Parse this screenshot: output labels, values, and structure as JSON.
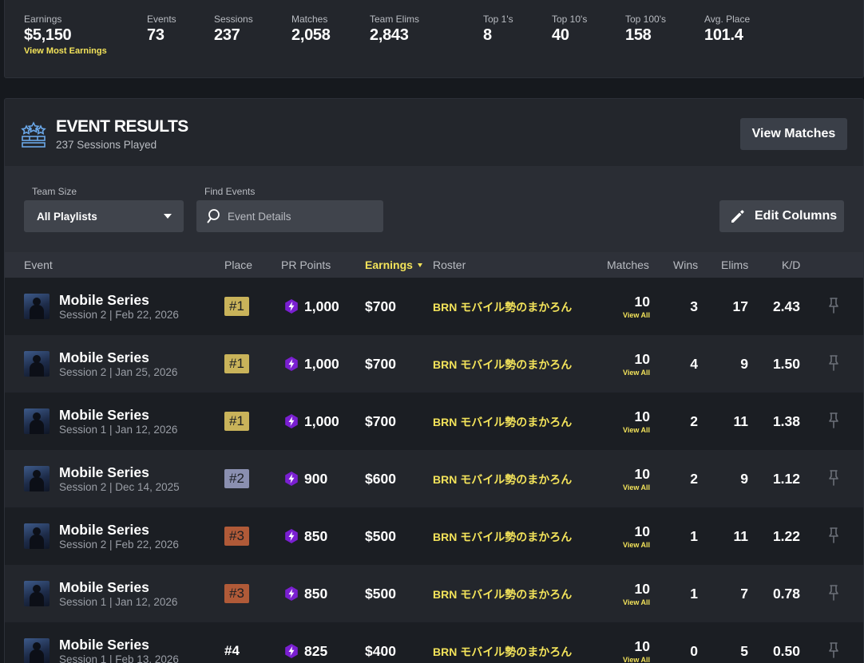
{
  "stats": {
    "earnings": {
      "label": "Earnings",
      "value": "$5,150",
      "link": "View Most Earnings"
    },
    "events": {
      "label": "Events",
      "value": "73"
    },
    "sessions": {
      "label": "Sessions",
      "value": "237"
    },
    "matches": {
      "label": "Matches",
      "value": "2,058"
    },
    "team_elims": {
      "label": "Team Elims",
      "value": "2,843"
    },
    "top1": {
      "label": "Top 1's",
      "value": "8"
    },
    "top10": {
      "label": "Top 10's",
      "value": "40"
    },
    "top100": {
      "label": "Top 100's",
      "value": "158"
    },
    "avg_place": {
      "label": "Avg. Place",
      "value": "101.4"
    }
  },
  "event_results": {
    "title": "EVENT RESULTS",
    "subtitle": "237 Sessions Played",
    "view_matches_label": "View Matches",
    "team_size_label": "Team Size",
    "team_size_value": "All Playlists",
    "find_events_label": "Find Events",
    "find_events_placeholder": "Event Details",
    "edit_columns_label": "Edit Columns"
  },
  "table": {
    "headers": {
      "event": "Event",
      "place": "Place",
      "pr_points": "PR Points",
      "earnings": "Earnings",
      "roster": "Roster",
      "matches": "Matches",
      "wins": "Wins",
      "elims": "Elims",
      "kd": "K/D"
    },
    "view_all_label": "View All",
    "rows": [
      {
        "name": "Mobile Series",
        "session": "Session 2 | Feb 22, 2026",
        "place": "#1",
        "place_style": "p1",
        "pr": "1,000",
        "earnings": "$700",
        "roster": "BRN モバイル勢のまかろん",
        "matches": "10",
        "wins": "3",
        "elims": "17",
        "kd": "2.43"
      },
      {
        "name": "Mobile Series",
        "session": "Session 2 | Jan 25, 2026",
        "place": "#1",
        "place_style": "p1",
        "pr": "1,000",
        "earnings": "$700",
        "roster": "BRN モバイル勢のまかろん",
        "matches": "10",
        "wins": "4",
        "elims": "9",
        "kd": "1.50"
      },
      {
        "name": "Mobile Series",
        "session": "Session 1 | Jan 12, 2026",
        "place": "#1",
        "place_style": "p1",
        "pr": "1,000",
        "earnings": "$700",
        "roster": "BRN モバイル勢のまかろん",
        "matches": "10",
        "wins": "2",
        "elims": "11",
        "kd": "1.38"
      },
      {
        "name": "Mobile Series",
        "session": "Session 2 | Dec 14, 2025",
        "place": "#2",
        "place_style": "p2",
        "pr": "900",
        "earnings": "$600",
        "roster": "BRN モバイル勢のまかろん",
        "matches": "10",
        "wins": "2",
        "elims": "9",
        "kd": "1.12"
      },
      {
        "name": "Mobile Series",
        "session": "Session 2 | Feb 22, 2026",
        "place": "#3",
        "place_style": "p3",
        "pr": "850",
        "earnings": "$500",
        "roster": "BRN モバイル勢のまかろん",
        "matches": "10",
        "wins": "1",
        "elims": "11",
        "kd": "1.22"
      },
      {
        "name": "Mobile Series",
        "session": "Session 1 | Jan 12, 2026",
        "place": "#3",
        "place_style": "p3",
        "pr": "850",
        "earnings": "$500",
        "roster": "BRN モバイル勢のまかろん",
        "matches": "10",
        "wins": "1",
        "elims": "7",
        "kd": "0.78"
      },
      {
        "name": "Mobile Series",
        "session": "Session 1 | Feb 13, 2026",
        "place": "#4",
        "place_style": "plain",
        "pr": "825",
        "earnings": "$400",
        "roster": "BRN モバイル勢のまかろん",
        "matches": "10",
        "wins": "0",
        "elims": "5",
        "kd": "0.50"
      }
    ]
  },
  "icons": {
    "header": "trophy-icon",
    "search": "search-icon",
    "edit": "pencil-icon",
    "pr": "bolt-icon",
    "pin": "pin-icon"
  },
  "colors": {
    "accent": "#f3e35a",
    "place1": "#c9b35a",
    "place2": "#8a8fb0",
    "place3": "#b05a38",
    "bolt": "#7a1fd1"
  }
}
